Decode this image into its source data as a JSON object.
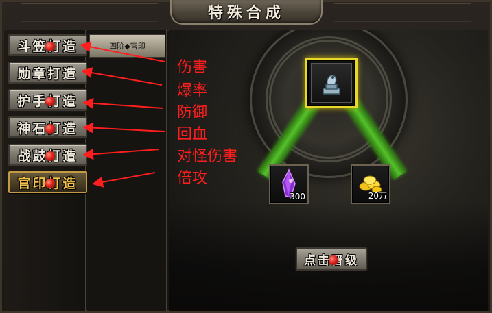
{
  "window": {
    "title": "特殊合成"
  },
  "craft_buttons": [
    {
      "label": "斗笠打造",
      "dot": true,
      "active": false
    },
    {
      "label": "勋章打造",
      "dot": false,
      "active": false
    },
    {
      "label": "护手打造",
      "dot": true,
      "active": false
    },
    {
      "label": "神石打造",
      "dot": true,
      "active": false
    },
    {
      "label": "战鼓打造",
      "dot": true,
      "active": false
    },
    {
      "label": "官印打造",
      "dot": true,
      "active": true
    }
  ],
  "sub_list": {
    "selected": "四阶◆官印"
  },
  "target_item": {
    "icon": "official-seal-icon"
  },
  "materials": [
    {
      "icon": "purple-crystal-icon",
      "quantity": "300"
    },
    {
      "icon": "gold-ingot-icon",
      "quantity": "20万"
    }
  ],
  "upgrade_button": {
    "label": "点击晋级"
  },
  "annotations": [
    "伤害",
    "爆率",
    "防御",
    "回血",
    "对怪伤害",
    "倍攻"
  ],
  "colors": {
    "annotation": "#ff1e1e",
    "target_highlight": "#e8d82a",
    "beam": "#54c22a",
    "active_text": "#f3c24a"
  }
}
